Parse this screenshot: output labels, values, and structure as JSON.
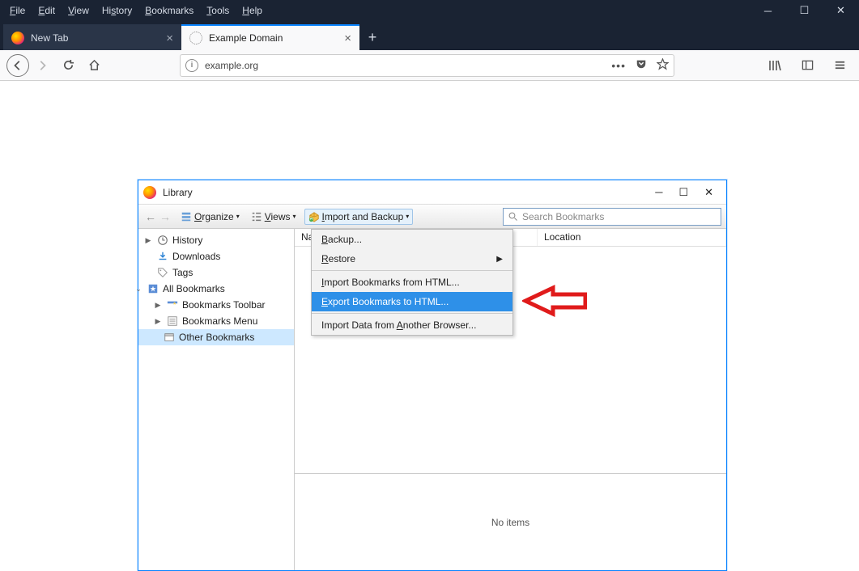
{
  "menubar": {
    "items": [
      "File",
      "Edit",
      "View",
      "History",
      "Bookmarks",
      "Tools",
      "Help"
    ]
  },
  "tabs": {
    "inactive": {
      "title": "New Tab"
    },
    "active": {
      "title": "Example Domain"
    }
  },
  "urlbar": {
    "url": "example.org"
  },
  "library": {
    "title": "Library",
    "toolbar": {
      "organize": "Organize",
      "views": "Views",
      "import_backup": "Import and Backup",
      "search_placeholder": "Search Bookmarks"
    },
    "columns": {
      "name": "Name",
      "location": "Location"
    },
    "sidebar": {
      "history": "History",
      "downloads": "Downloads",
      "tags": "Tags",
      "all_bookmarks": "All Bookmarks",
      "bookmarks_toolbar": "Bookmarks Toolbar",
      "bookmarks_menu": "Bookmarks Menu",
      "other_bookmarks": "Other Bookmarks"
    },
    "detail": "No items",
    "dropdown": {
      "backup": "Backup...",
      "restore": "Restore",
      "import_html": "Import Bookmarks from HTML...",
      "export_html": "Export Bookmarks to HTML...",
      "import_other": "Import Data from Another Browser..."
    }
  }
}
